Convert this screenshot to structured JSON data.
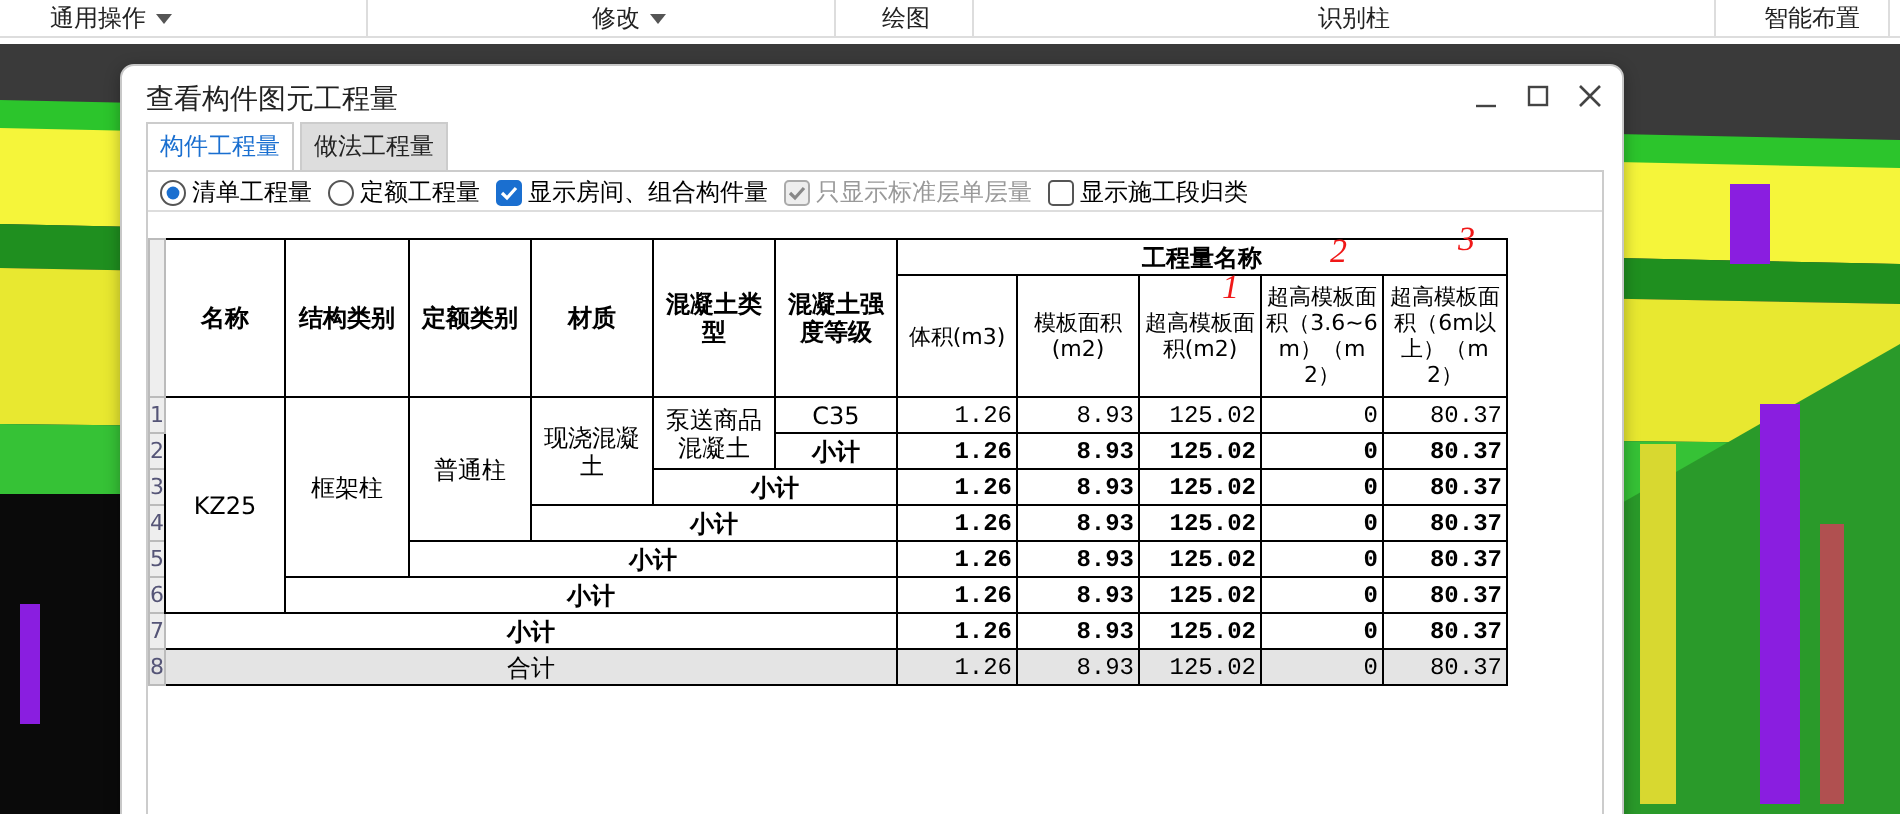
{
  "toolbar": [
    {
      "label": "通用操作",
      "dropdown": true
    },
    {
      "label": "修改",
      "dropdown": true
    },
    {
      "label": "绘图",
      "dropdown": false
    },
    {
      "label": "识别柱",
      "dropdown": false
    },
    {
      "label": "智能布置",
      "dropdown": false
    }
  ],
  "dialog": {
    "title": "查看构件图元工程量",
    "tabs": [
      {
        "label": "构件工程量",
        "selected": true
      },
      {
        "label": "做法工程量",
        "selected": false
      }
    ],
    "options": [
      {
        "kind": "radio",
        "label": "清单工程量",
        "selected": true
      },
      {
        "kind": "radio",
        "label": "定额工程量",
        "selected": false
      },
      {
        "kind": "checkbox",
        "label": "显示房间、组合构件量",
        "checked": true,
        "disabled": false
      },
      {
        "kind": "checkbox",
        "label": "只显示标准层单层量",
        "checked": true,
        "disabled": true
      },
      {
        "kind": "checkbox",
        "label": "显示施工段归类",
        "checked": false,
        "disabled": false
      }
    ],
    "table": {
      "columns": [
        "名称",
        "结构类别",
        "定额类别",
        "材质",
        "混凝土类型",
        "混凝土强度等级"
      ],
      "group_header": "工程量名称",
      "value_columns": [
        "体积(m3)",
        "模板面积(m2)",
        "超高模板面积(m2)",
        "超高模板面积（3.6~6m）（m2）",
        "超高模板面积（6m以上）（m2）"
      ],
      "row_numbers": [
        "1",
        "2",
        "3",
        "4",
        "5",
        "6",
        "7",
        "8"
      ],
      "groups": [
        {
          "label": "KZ25",
          "subtotal": {
            "label": "小计",
            "values": [
              "1.26",
              "8.93",
              "125.02",
              "0",
              "80.37"
            ]
          },
          "children": [
            {
              "label": "框架柱",
              "subtotal": {
                "label": "小计",
                "values": [
                  "1.26",
                  "8.93",
                  "125.02",
                  "0",
                  "80.37"
                ]
              },
              "children": [
                {
                  "label": "普通柱",
                  "subtotal": {
                    "label": "小计",
                    "values": [
                      "1.26",
                      "8.93",
                      "125.02",
                      "0",
                      "80.37"
                    ]
                  },
                  "children": [
                    {
                      "label": "现浇混凝土",
                      "subtotal": {
                        "label": "小计",
                        "values": [
                          "1.26",
                          "8.93",
                          "125.02",
                          "0",
                          "80.37"
                        ]
                      },
                      "children": [
                        {
                          "label": "泵送商品混凝土",
                          "subtotal": {
                            "label": "小计",
                            "values": [
                              "1.26",
                              "8.93",
                              "125.02",
                              "0",
                              "80.37"
                            ]
                          },
                          "children": [
                            {
                              "label": "C35",
                              "values": [
                                "1.26",
                                "8.93",
                                "125.02",
                                "0",
                                "80.37"
                              ]
                            }
                          ]
                        }
                      ]
                    }
                  ]
                }
              ]
            }
          ]
        }
      ],
      "subtotal": {
        "label": "小计",
        "values": [
          "1.26",
          "8.93",
          "125.02",
          "0",
          "80.37"
        ]
      },
      "total": {
        "label": "合计",
        "values": [
          "1.26",
          "8.93",
          "125.02",
          "0",
          "80.37"
        ]
      }
    },
    "annotations": [
      {
        "text": "1"
      },
      {
        "text": "2"
      },
      {
        "text": "3"
      }
    ]
  }
}
